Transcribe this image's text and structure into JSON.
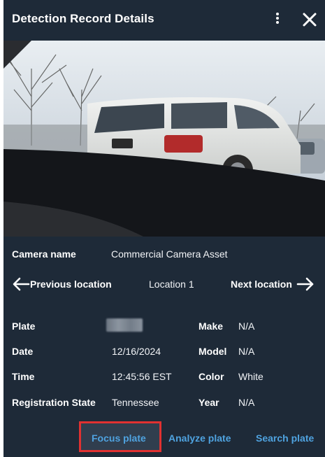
{
  "header": {
    "title": "Detection Record Details",
    "menu_icon": "more-vertical-icon",
    "close_icon": "close-icon"
  },
  "image": {
    "description_icon": "camera-snapshot-image"
  },
  "camera": {
    "label": "Camera name",
    "value": "Commercial Camera Asset"
  },
  "location_nav": {
    "previous_label": "Previous location",
    "current_label": "Location 1",
    "next_label": "Next location"
  },
  "details": {
    "plate_label": "Plate",
    "date_label": "Date",
    "date_value": "12/16/2024",
    "time_label": "Time",
    "time_value": "12:45:56 EST",
    "registration_state_label": "Registration State",
    "registration_state_value": "Tennessee",
    "make_label": "Make",
    "make_value": "N/A",
    "model_label": "Model",
    "model_value": "N/A",
    "color_label": "Color",
    "color_value": "White",
    "year_label": "Year",
    "year_value": "N/A"
  },
  "actions": {
    "focus_plate": "Focus plate",
    "analyze_plate": "Analyze plate",
    "search_plate": "Search plate"
  },
  "colors": {
    "panel_bg": "#1e2a38",
    "link_blue": "#4fa3e0",
    "highlight_red": "#e03131"
  }
}
